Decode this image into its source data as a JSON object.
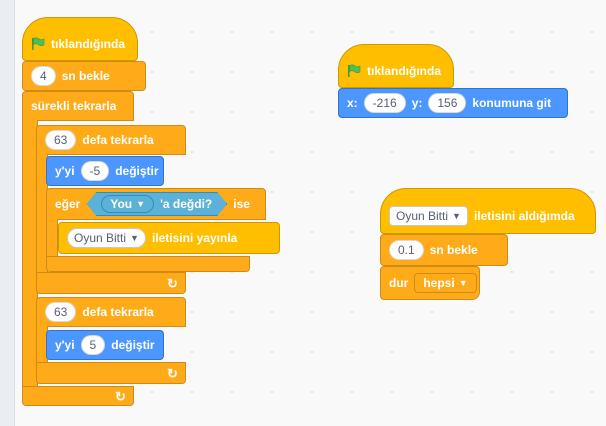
{
  "script1": {
    "hat_label": "tıklandığında",
    "wait_value": "4",
    "wait_label": "sn bekle",
    "forever_label": "sürekli tekrarla",
    "repeat1_value": "63",
    "repeat1_label": "defa tekrarla",
    "change1_prefix": "y'yi",
    "change1_value": "-5",
    "change1_suffix": "değiştir",
    "if_label": "eğer",
    "touching_target": "You",
    "touching_label": "'a değdi?",
    "if_then": "ise",
    "broadcast_message": "Oyun Bitti",
    "broadcast_label": "iletisini yayınla",
    "repeat2_value": "63",
    "repeat2_label": "defa tekrarla",
    "change2_prefix": "y'yi",
    "change2_value": "5",
    "change2_suffix": "değiştir"
  },
  "script2": {
    "hat_label": "tıklandığında",
    "x_label": "x:",
    "x_value": "-216",
    "y_label": "y:",
    "y_value": "156",
    "goto_label": "konumuna git"
  },
  "script3": {
    "hat_message": "Oyun Bitti",
    "hat_label": "iletisini aldığımda",
    "wait_value": "0.1",
    "wait_label": "sn bekle",
    "stop_label": "dur",
    "stop_option": "hepsi"
  },
  "colors": {
    "events": "#ffbf00",
    "control": "#ffab19",
    "motion": "#4c97ff",
    "sensing": "#5cb1d6"
  }
}
